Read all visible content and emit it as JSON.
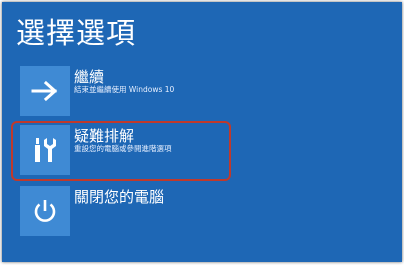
{
  "screen": {
    "title": "選擇選項",
    "background": "#1e67b5",
    "tile_color": "#3f8ad4",
    "highlight_color": "#c0392b"
  },
  "options": [
    {
      "icon": "arrow-right-icon",
      "label": "繼續",
      "description": "結束並繼續使用 Windows 10"
    },
    {
      "icon": "tools-icon",
      "label": "疑難排解",
      "description": "重設您的電腦或參閱進階選項",
      "highlighted": true
    },
    {
      "icon": "power-icon",
      "label": "關閉您的電腦",
      "description": ""
    }
  ]
}
